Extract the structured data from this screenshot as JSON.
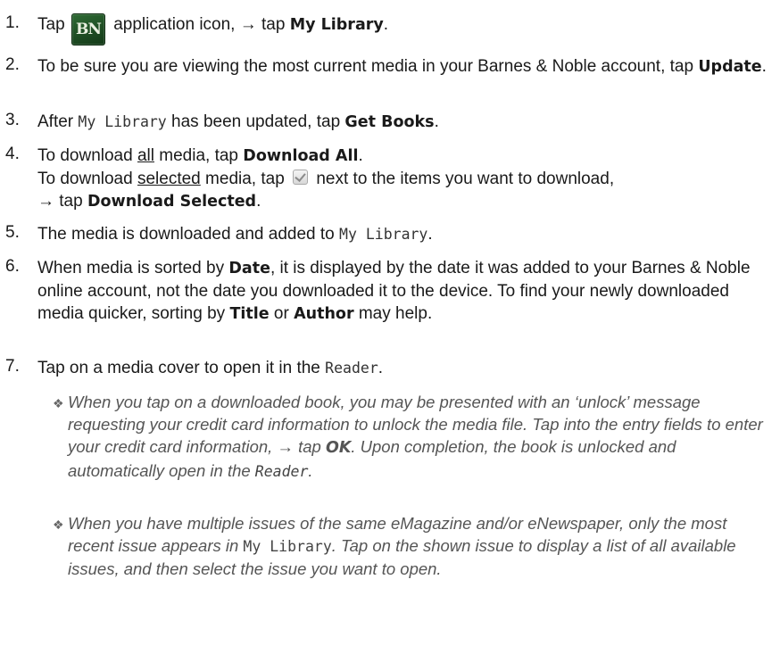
{
  "steps": [
    {
      "num": "1.",
      "a": "Tap",
      "icon": "BN",
      "b": "application icon, → tap",
      "c": "My Library",
      "d": "."
    },
    {
      "num": "2.",
      "a": "To be sure you are viewing the most current media in your Barnes & Noble account, tap",
      "b": "Update",
      "c": "."
    },
    {
      "num": "3.",
      "a": "After",
      "b": "My Library",
      "c": "has been updated, tap",
      "d": "Get Books",
      "e": "."
    },
    {
      "num": "4.",
      "a": "To download",
      "b": "all",
      "c": "media, tap",
      "d": "Download All",
      "e": ".",
      "f": "To download",
      "g": "selected",
      "h": "media, tap",
      "i": "next to the items you want to download,",
      "j": "→ tap",
      "k": "Download Selected",
      "l": "."
    },
    {
      "num": "5.",
      "a": "The media is downloaded and added to",
      "b": "My Library",
      "c": "."
    },
    {
      "num": "6.",
      "a": "When media is sorted by",
      "b": "Date",
      "c": ", it is displayed by the date it was added to your Barnes & Noble online account, not the date you downloaded it to the device. To find your newly downloaded media quicker, sorting by",
      "d": "Title",
      "e": "or",
      "f": "Author",
      "g": "may help."
    },
    {
      "num": "7.",
      "a": "Tap on a media cover to open it in the",
      "b": "Reader",
      "c": "."
    }
  ],
  "notes": [
    {
      "a": "When you tap on a downloaded book, you may be presented with an ‘unlock’ message requesting your credit card information to unlock the media file. Tap into the entry fields to enter your credit card information, → tap",
      "b": "OK",
      "c": ". Upon completion, the book is unlocked and automatically open in the",
      "d": "Reader",
      "e": "."
    },
    {
      "a": "When you have multiple issues of the same eMagazine and/or eNewspaper, only the most recent issue appears in",
      "b": "My Library",
      "c": ". Tap on the shown issue to display a list of all available issues, and then select the issue you want to open."
    }
  ],
  "icons": {
    "bn_app": "bn-app-icon",
    "checkbox": "checkbox-icon",
    "bullet": "diamond-bullet-icon"
  },
  "colors": {
    "text": "#1a1a1a",
    "note_text": "#555555",
    "bn_green": "#2f6b35"
  }
}
